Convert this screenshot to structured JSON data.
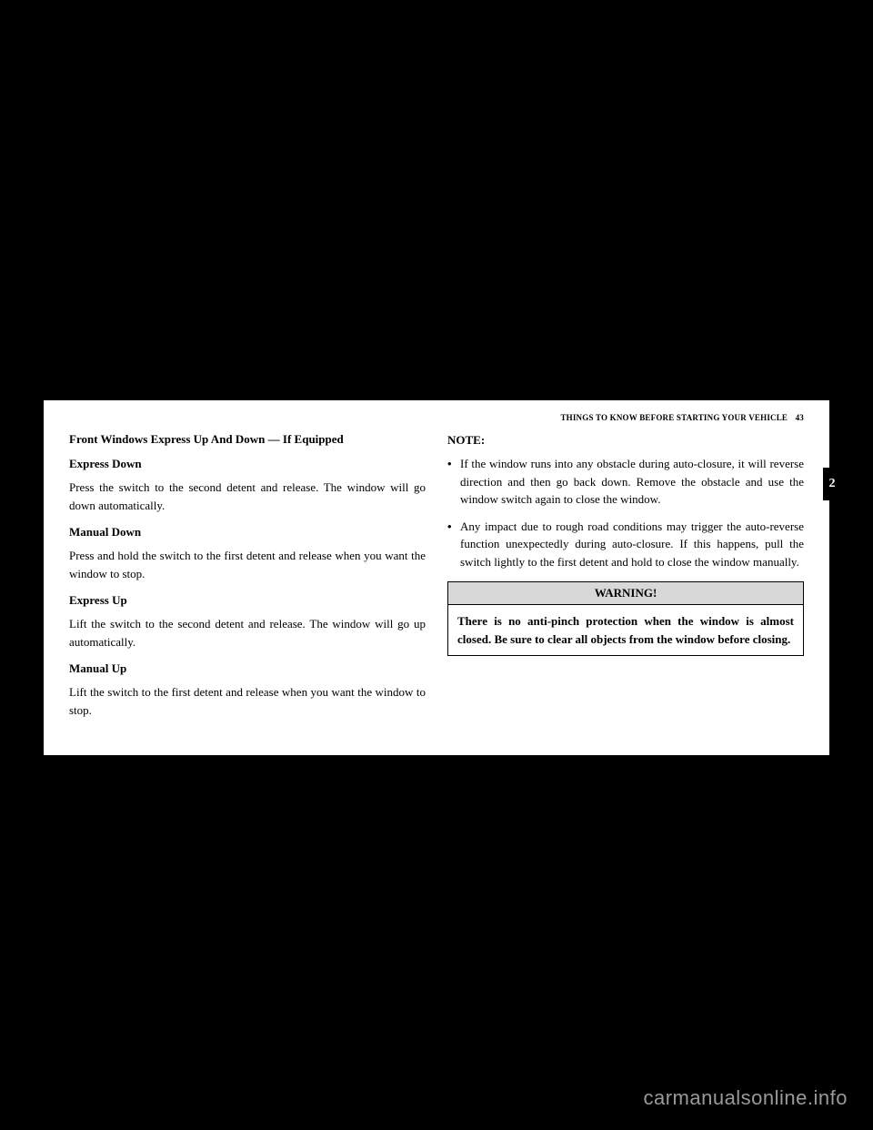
{
  "header": {
    "section_title": "THINGS TO KNOW BEFORE STARTING YOUR VEHICLE",
    "page_number": "43"
  },
  "side_tab": "2",
  "left": {
    "title": "Front Windows Express Up And Down — If Equipped",
    "sections": [
      {
        "heading": "Express Down",
        "body": "Press the switch to the second detent and release. The window will go down automatically."
      },
      {
        "heading": "Manual Down",
        "body": "Press and hold the switch to the first detent and release when you want the window to stop."
      },
      {
        "heading": "Express Up",
        "body": "Lift the switch to the second detent and release. The window will go up automatically."
      },
      {
        "heading": "Manual Up",
        "body": "Lift the switch to the first detent and release when you want the window to stop."
      }
    ]
  },
  "right": {
    "note_label": "NOTE:",
    "bullets": [
      "If the window runs into any obstacle during auto-closure, it will reverse direction and then go back down. Remove the obstacle and use the window switch again to close the window.",
      "Any impact due to rough road conditions may trigger the auto-reverse function unexpectedly during auto-closure. If this happens, pull the switch lightly to the first detent and hold to close the window manually."
    ],
    "warning": {
      "title": "WARNING!",
      "body": "There is no anti-pinch protection when the window is almost closed. Be sure to clear all objects from the window before closing."
    }
  },
  "watermark": "carmanualsonline.info"
}
